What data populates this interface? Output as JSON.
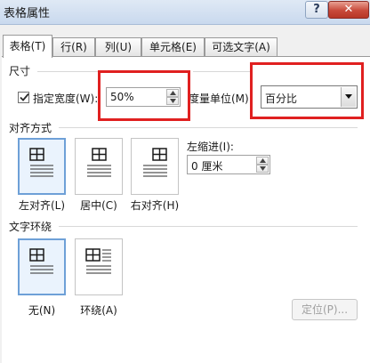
{
  "window": {
    "title": "表格属性",
    "help_label": "?",
    "close_label": "✕"
  },
  "tabs": [
    {
      "label": "表格(T)",
      "active": true
    },
    {
      "label": "行(R)",
      "active": false
    },
    {
      "label": "列(U)",
      "active": false
    },
    {
      "label": "单元格(E)",
      "active": false
    },
    {
      "label": "可选文字(A)",
      "active": false
    }
  ],
  "size": {
    "heading": "尺寸",
    "preferred_width_label": "指定宽度(W):",
    "preferred_width_checked": true,
    "width_value": "50%",
    "measure_label": "度量单位(M):",
    "measure_value": "百分比"
  },
  "alignment": {
    "heading": "对齐方式",
    "options": [
      {
        "label": "左对齐(L)",
        "selected": true
      },
      {
        "label": "居中(C)",
        "selected": false
      },
      {
        "label": "右对齐(H)",
        "selected": false
      }
    ],
    "indent_label": "左缩进(I):",
    "indent_value": "0 厘米"
  },
  "wrapping": {
    "heading": "文字环绕",
    "options": [
      {
        "label": "无(N)",
        "selected": true
      },
      {
        "label": "环绕(A)",
        "selected": false
      }
    ],
    "positioning_button": "定位(P)..."
  },
  "colors": {
    "highlight": "#e02020",
    "selected_tile_border": "#6ea0d7",
    "selected_tile_bg": "#eaf3fd"
  },
  "icons": [
    "help-icon",
    "close-icon",
    "checkmark-icon",
    "spin-up-icon",
    "spin-down-icon",
    "dropdown-arrow-icon"
  ]
}
